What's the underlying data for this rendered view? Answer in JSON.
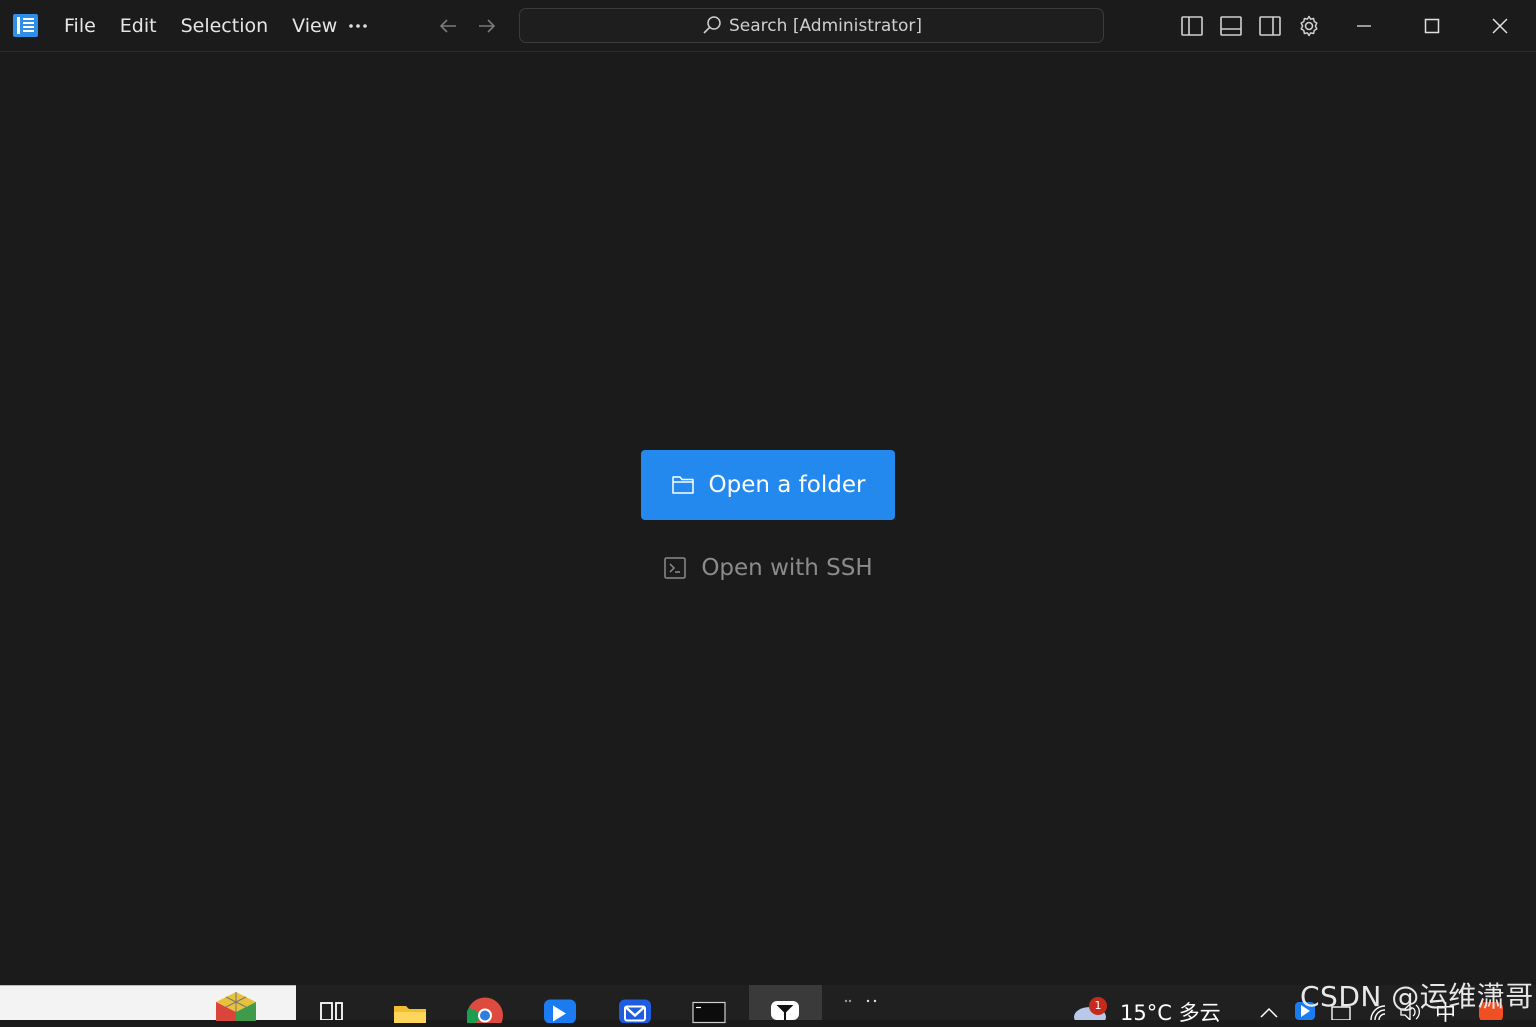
{
  "titlebar": {
    "menu": [
      "File",
      "Edit",
      "Selection",
      "View"
    ],
    "more_label": "···",
    "search": {
      "text": "Search [Administrator]",
      "icon": "search-icon"
    },
    "toolbar_icons": [
      "toggle-left-sidebar-icon",
      "toggle-bottom-panel-icon",
      "toggle-right-sidebar-icon",
      "gear-icon"
    ],
    "window_controls": [
      "minimize-icon",
      "maximize-icon",
      "close-icon"
    ]
  },
  "welcome": {
    "open_folder_label": "Open a folder",
    "open_ssh_label": "Open with SSH",
    "accent_color": "#2489ef"
  },
  "taskbar": {
    "weather_temp": "15°C",
    "weather_desc": "多云",
    "notification_count": "1",
    "ime_label": "中",
    "apps": [
      "rubiks-cube-icon",
      "task-view-icon",
      "file-explorer-icon",
      "chrome-icon",
      "feishu-icon",
      "mail-icon",
      "terminal-icon",
      "editor-icon"
    ]
  },
  "watermark": "CSDN @运维潇哥"
}
